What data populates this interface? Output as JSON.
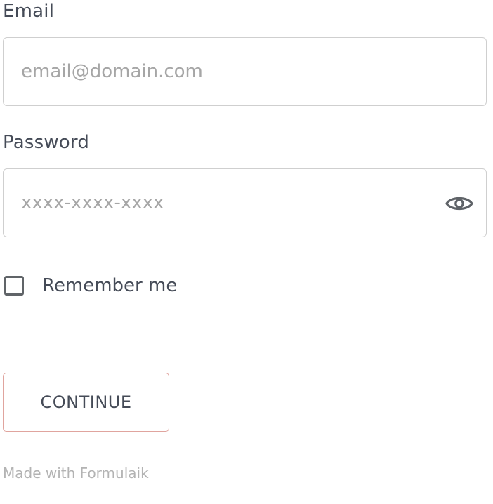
{
  "form": {
    "email": {
      "label": "Email",
      "value": "",
      "placeholder": "email@domain.com"
    },
    "password": {
      "label": "Password",
      "value": "",
      "placeholder": "xxxx-xxxx-xxxx",
      "toggle_icon": "eye-icon"
    },
    "remember": {
      "label": "Remember me",
      "checked": false
    },
    "submit_label": "CONTINUE"
  },
  "footer": {
    "text": "Made with Formulaik"
  },
  "colors": {
    "text": "#454b57",
    "placeholder": "#a6a6a6",
    "field_border": "#cfcfcf",
    "button_border": "#e0a49e",
    "footer_text": "#b3b3b3"
  }
}
